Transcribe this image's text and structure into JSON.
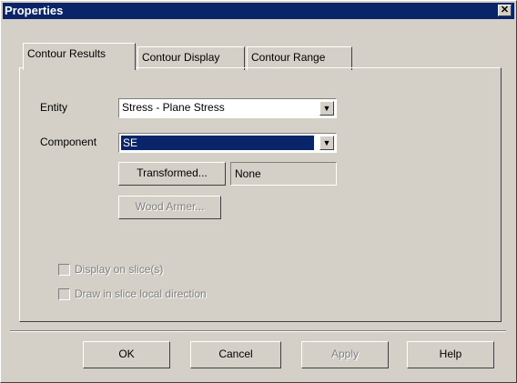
{
  "window": {
    "title": "Properties",
    "close_glyph": "✕"
  },
  "tabs": [
    {
      "label": "Contour Results",
      "active": true
    },
    {
      "label": "Contour Display",
      "active": false
    },
    {
      "label": "Contour Range",
      "active": false
    }
  ],
  "form": {
    "entity_label": "Entity",
    "entity_value": "Stress - Plane Stress",
    "component_label": "Component",
    "component_value": "SE",
    "transformed_button": "Transformed...",
    "transformed_value": "None",
    "wood_armer_button": "Wood Armer...",
    "checkbox_display_slice": "Display on slice(s)",
    "checkbox_draw_local": "Draw in slice local direction"
  },
  "buttons": {
    "ok": "OK",
    "cancel": "Cancel",
    "apply": "Apply",
    "help": "Help"
  },
  "colors": {
    "titlebar": "#0a246a",
    "face": "#d4d0c8",
    "selection": "#0a246a"
  }
}
